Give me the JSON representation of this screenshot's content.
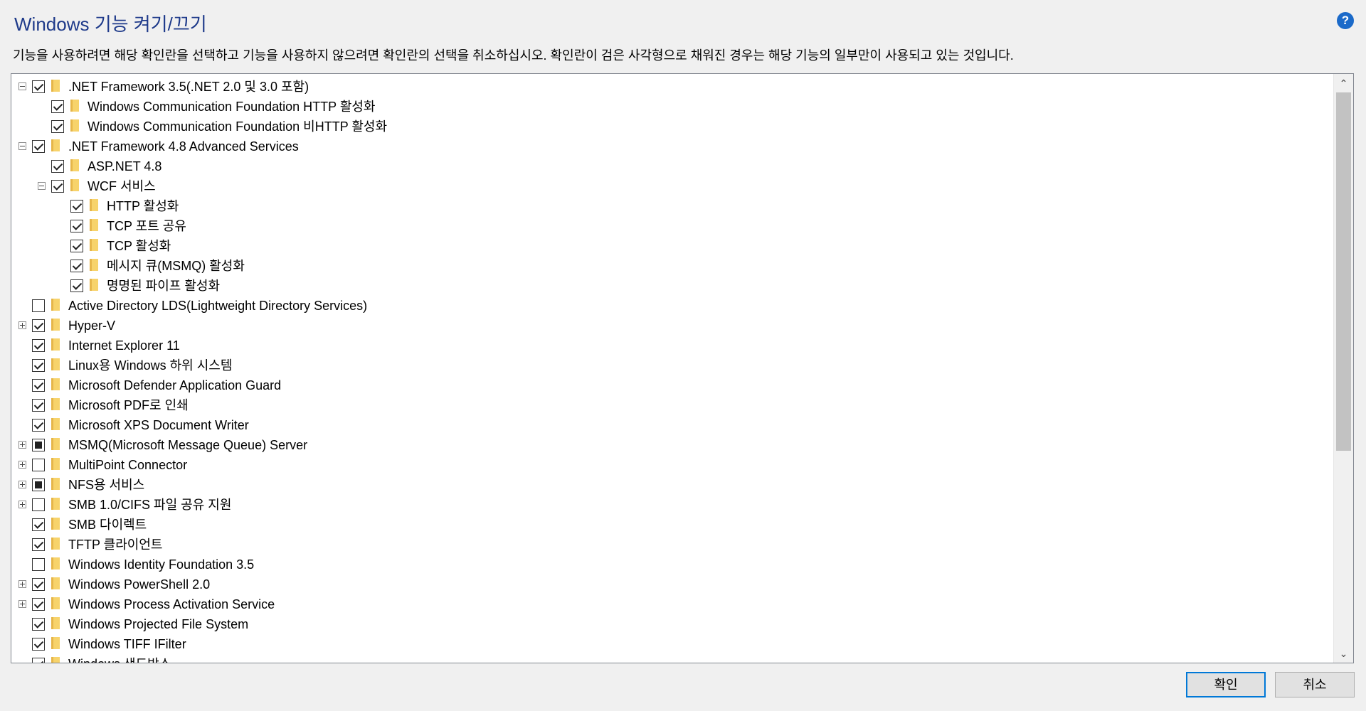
{
  "window": {
    "title": "Windows 기능 켜기/끄기",
    "help_icon": "?",
    "description": "기능을 사용하려면 해당 확인란을 선택하고 기능을 사용하지 않으려면 확인란의 선택을 취소하십시오. 확인란이 검은 사각형으로 채워진 경우는 해당 기능의 일부만이 사용되고 있는 것입니다."
  },
  "tree": {
    "items": [
      {
        "label": ".NET Framework 3.5(.NET 2.0 및 3.0 포함)",
        "level": 0,
        "expander": "minus",
        "check": "checked"
      },
      {
        "label": "Windows Communication Foundation HTTP 활성화",
        "level": 1,
        "expander": "none",
        "check": "checked"
      },
      {
        "label": "Windows Communication Foundation 비HTTP 활성화",
        "level": 1,
        "expander": "none",
        "check": "checked"
      },
      {
        "label": ".NET Framework 4.8 Advanced Services",
        "level": 0,
        "expander": "minus",
        "check": "checked"
      },
      {
        "label": "ASP.NET 4.8",
        "level": 1,
        "expander": "none",
        "check": "checked"
      },
      {
        "label": "WCF 서비스",
        "level": 1,
        "expander": "minus",
        "check": "checked"
      },
      {
        "label": "HTTP 활성화",
        "level": 2,
        "expander": "none",
        "check": "checked"
      },
      {
        "label": "TCP 포트 공유",
        "level": 2,
        "expander": "none",
        "check": "checked"
      },
      {
        "label": "TCP 활성화",
        "level": 2,
        "expander": "none",
        "check": "checked"
      },
      {
        "label": "메시지 큐(MSMQ) 활성화",
        "level": 2,
        "expander": "none",
        "check": "checked"
      },
      {
        "label": "명명된 파이프 활성화",
        "level": 2,
        "expander": "none",
        "check": "checked"
      },
      {
        "label": "Active Directory LDS(Lightweight Directory Services)",
        "level": 0,
        "expander": "none",
        "check": "unchecked"
      },
      {
        "label": "Hyper-V",
        "level": 0,
        "expander": "plus",
        "check": "checked"
      },
      {
        "label": "Internet Explorer 11",
        "level": 0,
        "expander": "none",
        "check": "checked"
      },
      {
        "label": "Linux용 Windows 하위 시스템",
        "level": 0,
        "expander": "none",
        "check": "checked"
      },
      {
        "label": "Microsoft Defender Application Guard",
        "level": 0,
        "expander": "none",
        "check": "checked"
      },
      {
        "label": "Microsoft PDF로 인쇄",
        "level": 0,
        "expander": "none",
        "check": "checked"
      },
      {
        "label": "Microsoft XPS Document Writer",
        "level": 0,
        "expander": "none",
        "check": "checked"
      },
      {
        "label": "MSMQ(Microsoft Message Queue) Server",
        "level": 0,
        "expander": "plus",
        "check": "partial"
      },
      {
        "label": "MultiPoint Connector",
        "level": 0,
        "expander": "plus",
        "check": "unchecked"
      },
      {
        "label": "NFS용 서비스",
        "level": 0,
        "expander": "plus",
        "check": "partial"
      },
      {
        "label": "SMB 1.0/CIFS 파일 공유 지원",
        "level": 0,
        "expander": "plus",
        "check": "unchecked"
      },
      {
        "label": "SMB 다이렉트",
        "level": 0,
        "expander": "none",
        "check": "checked"
      },
      {
        "label": "TFTP 클라이언트",
        "level": 0,
        "expander": "none",
        "check": "checked"
      },
      {
        "label": "Windows Identity Foundation 3.5",
        "level": 0,
        "expander": "none",
        "check": "unchecked"
      },
      {
        "label": "Windows PowerShell 2.0",
        "level": 0,
        "expander": "plus",
        "check": "checked"
      },
      {
        "label": "Windows Process Activation Service",
        "level": 0,
        "expander": "plus",
        "check": "checked"
      },
      {
        "label": "Windows Projected File System",
        "level": 0,
        "expander": "none",
        "check": "checked"
      },
      {
        "label": "Windows TIFF IFilter",
        "level": 0,
        "expander": "none",
        "check": "checked"
      },
      {
        "label": "Windows 샌드박스",
        "level": 0,
        "expander": "none",
        "check": "checked"
      }
    ]
  },
  "scrollbar": {
    "up_arrow": "⌃",
    "down_arrow": "⌄"
  },
  "buttons": {
    "ok_label": "확인",
    "cancel_label": "취소"
  },
  "colors": {
    "title": "#1e3a8a",
    "accent": "#0078d7",
    "folder": "#f7d36b"
  }
}
